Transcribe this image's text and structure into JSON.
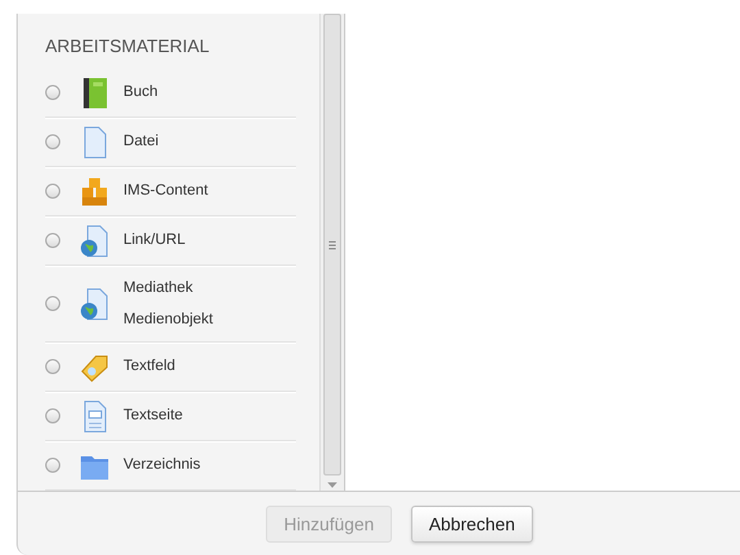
{
  "section": {
    "title": "ARBEITSMATERIAL"
  },
  "items": [
    {
      "label": "Buch",
      "kind": "book",
      "selected": false
    },
    {
      "label": "Datei",
      "kind": "file",
      "selected": false
    },
    {
      "label": "IMS-Content",
      "kind": "boxes",
      "selected": false
    },
    {
      "label": "Link/URL",
      "kind": "weblink",
      "selected": false
    },
    {
      "label": "Mediathek Medienobjekt",
      "kind": "weblink",
      "selected": false
    },
    {
      "label": "Textfeld",
      "kind": "tag",
      "selected": false
    },
    {
      "label": "Textseite",
      "kind": "page",
      "selected": false
    },
    {
      "label": "Verzeichnis",
      "kind": "folder",
      "selected": false
    }
  ],
  "buttons": [
    {
      "label": "Hinzufügen",
      "disabled": true
    },
    {
      "label": "Abbrechen",
      "disabled": false
    }
  ]
}
